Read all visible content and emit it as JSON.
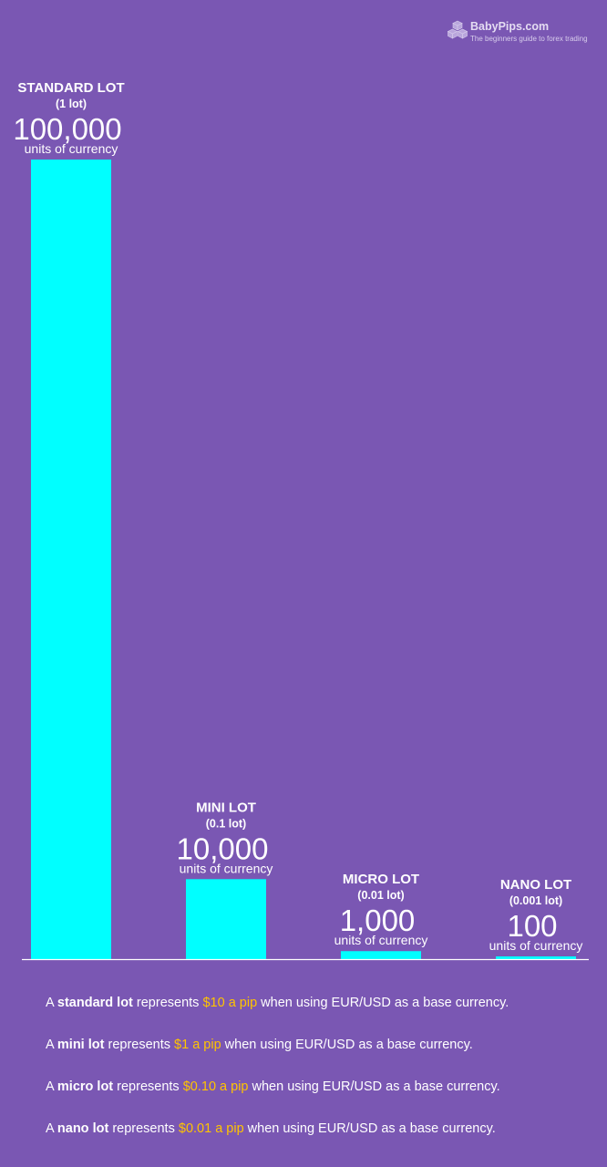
{
  "brand": {
    "name": "BabyPips.com",
    "tagline": "The beginners guide to forex trading",
    "icon": "cubes-icon"
  },
  "colors": {
    "background": "#7a57b3",
    "bar": "#00ffff",
    "highlight": "#ffc400",
    "text": "#ffffff"
  },
  "chart_data": {
    "type": "bar",
    "title": "",
    "xlabel": "",
    "ylabel": "",
    "ylim": [
      0,
      100000
    ],
    "grid": false,
    "legend": "none",
    "categories": [
      "STANDARD LOT",
      "MINI LOT",
      "MICRO LOT",
      "NANO LOT"
    ],
    "sublabels": [
      "(1 lot)",
      "(0.1 lot)",
      "(0.01 lot)",
      "(0.001 lot)"
    ],
    "value_labels": [
      "100,000",
      "10,000",
      "1,000",
      "100"
    ],
    "unit_label": "units of currency",
    "values": [
      100000,
      10000,
      1000,
      100
    ]
  },
  "notes": [
    {
      "prefix": "A ",
      "lot": "standard lot",
      "mid": " represents ",
      "pip": "$10 a pip",
      "suffix": " when using EUR/USD as a base currency."
    },
    {
      "prefix": "A ",
      "lot": "mini lot",
      "mid": " represents ",
      "pip": "$1 a pip",
      "suffix": " when using EUR/USD as a base currency."
    },
    {
      "prefix": "A ",
      "lot": "micro lot",
      "mid": " represents ",
      "pip": "$0.10 a pip",
      "suffix": " when using EUR/USD as a base currency."
    },
    {
      "prefix": "A ",
      "lot": "nano lot",
      "mid": " represents ",
      "pip": "$0.01 a pip",
      "suffix": " when using EUR/USD as a base currency."
    }
  ]
}
